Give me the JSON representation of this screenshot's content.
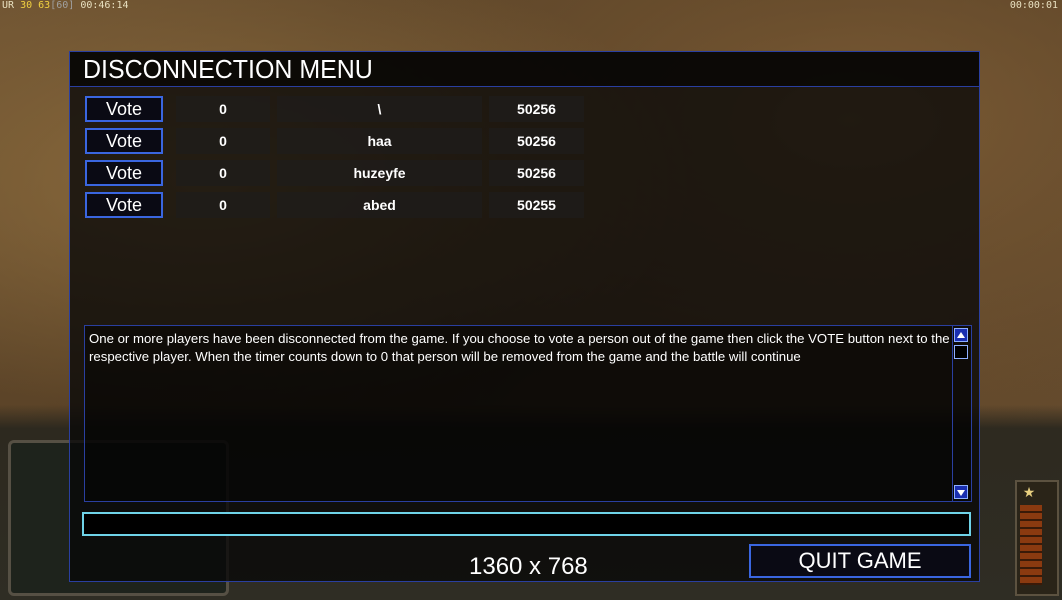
{
  "overlay": {
    "left_prefix": "UR",
    "left_num1": "30",
    "left_num2": "63",
    "left_bracket": "[60]",
    "left_time": "00:46:14",
    "right_time": "00:00:01"
  },
  "dialog": {
    "title": "DISCONNECTION MENU",
    "players": [
      {
        "vote_label": "Vote",
        "votes": "0",
        "name": "\\",
        "ping": "50256"
      },
      {
        "vote_label": "Vote",
        "votes": "0",
        "name": "haa",
        "ping": "50256"
      },
      {
        "vote_label": "Vote",
        "votes": "0",
        "name": "huzeyfe",
        "ping": "50256"
      },
      {
        "vote_label": "Vote",
        "votes": "0",
        "name": "abed",
        "ping": "50255"
      }
    ],
    "message": "One or more players have been disconnected from the game. If you choose to vote a person out of the game then click the VOTE button next to the respective player. When the timer counts down to 0 that person will be removed from the game and the battle will continue",
    "chat_value": "",
    "resolution": "1360 x 768",
    "quit_label": "QUIT GAME"
  },
  "colors": {
    "accent_blue": "#3a66e0",
    "input_cyan": "#6fd3e8"
  }
}
